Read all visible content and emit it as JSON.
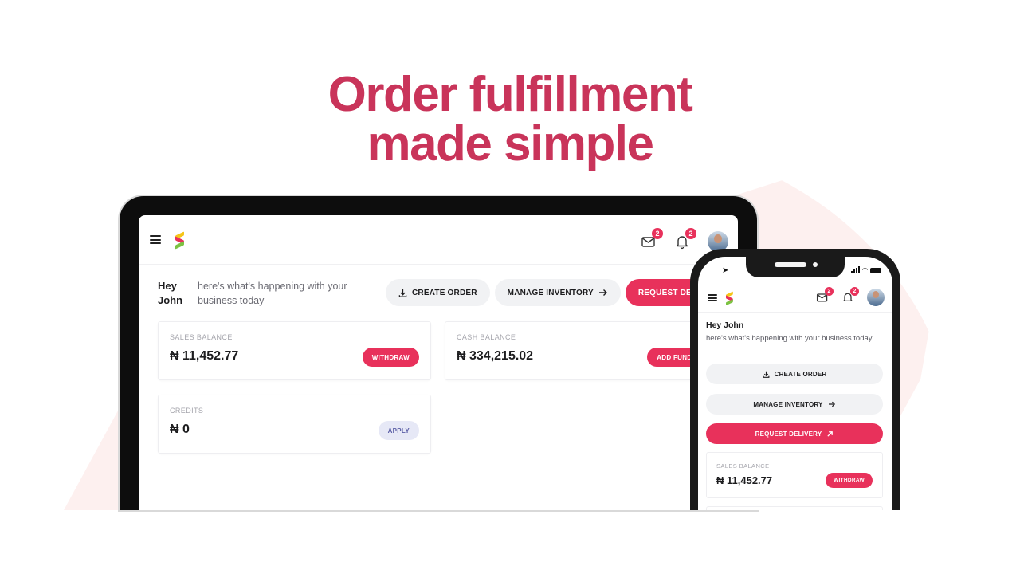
{
  "hero": {
    "line1": "Order fulfillment",
    "line2": "made simple"
  },
  "colors": {
    "accent": "#e8315b",
    "headline": "#c9345a",
    "blob": "#fdf0ef",
    "apply_bg": "#e6e8f6",
    "apply_text": "#5b5ea6"
  },
  "app": {
    "greeting_name": "Hey John",
    "greeting_hey": "Hey",
    "greeting_john": "John",
    "greeting_sub": "here's what's happening with your business today",
    "mail_badge": "2",
    "bell_badge": "2",
    "icons": {
      "menu": "hamburger-menu-icon",
      "mail": "mail-icon",
      "bell": "bell-icon",
      "download": "download-icon",
      "arrow_right": "arrow-right-icon",
      "arrow_up_right": "arrow-up-right-icon"
    },
    "actions": {
      "create_order": "CREATE ORDER",
      "manage_inventory": "MANAGE INVENTORY",
      "request_delivery": "REQUEST DELIVERY"
    },
    "cards": {
      "sales_balance": {
        "label": "SALES BALANCE",
        "value": "₦ 11,452.77",
        "button": "WITHDRAW"
      },
      "cash_balance": {
        "label": "CASH BALANCE",
        "value": "₦ 334,215.02",
        "button": "ADD FUNDS"
      },
      "credits": {
        "label": "CREDITS",
        "value": "₦ 0",
        "button": "APPLY"
      }
    }
  }
}
